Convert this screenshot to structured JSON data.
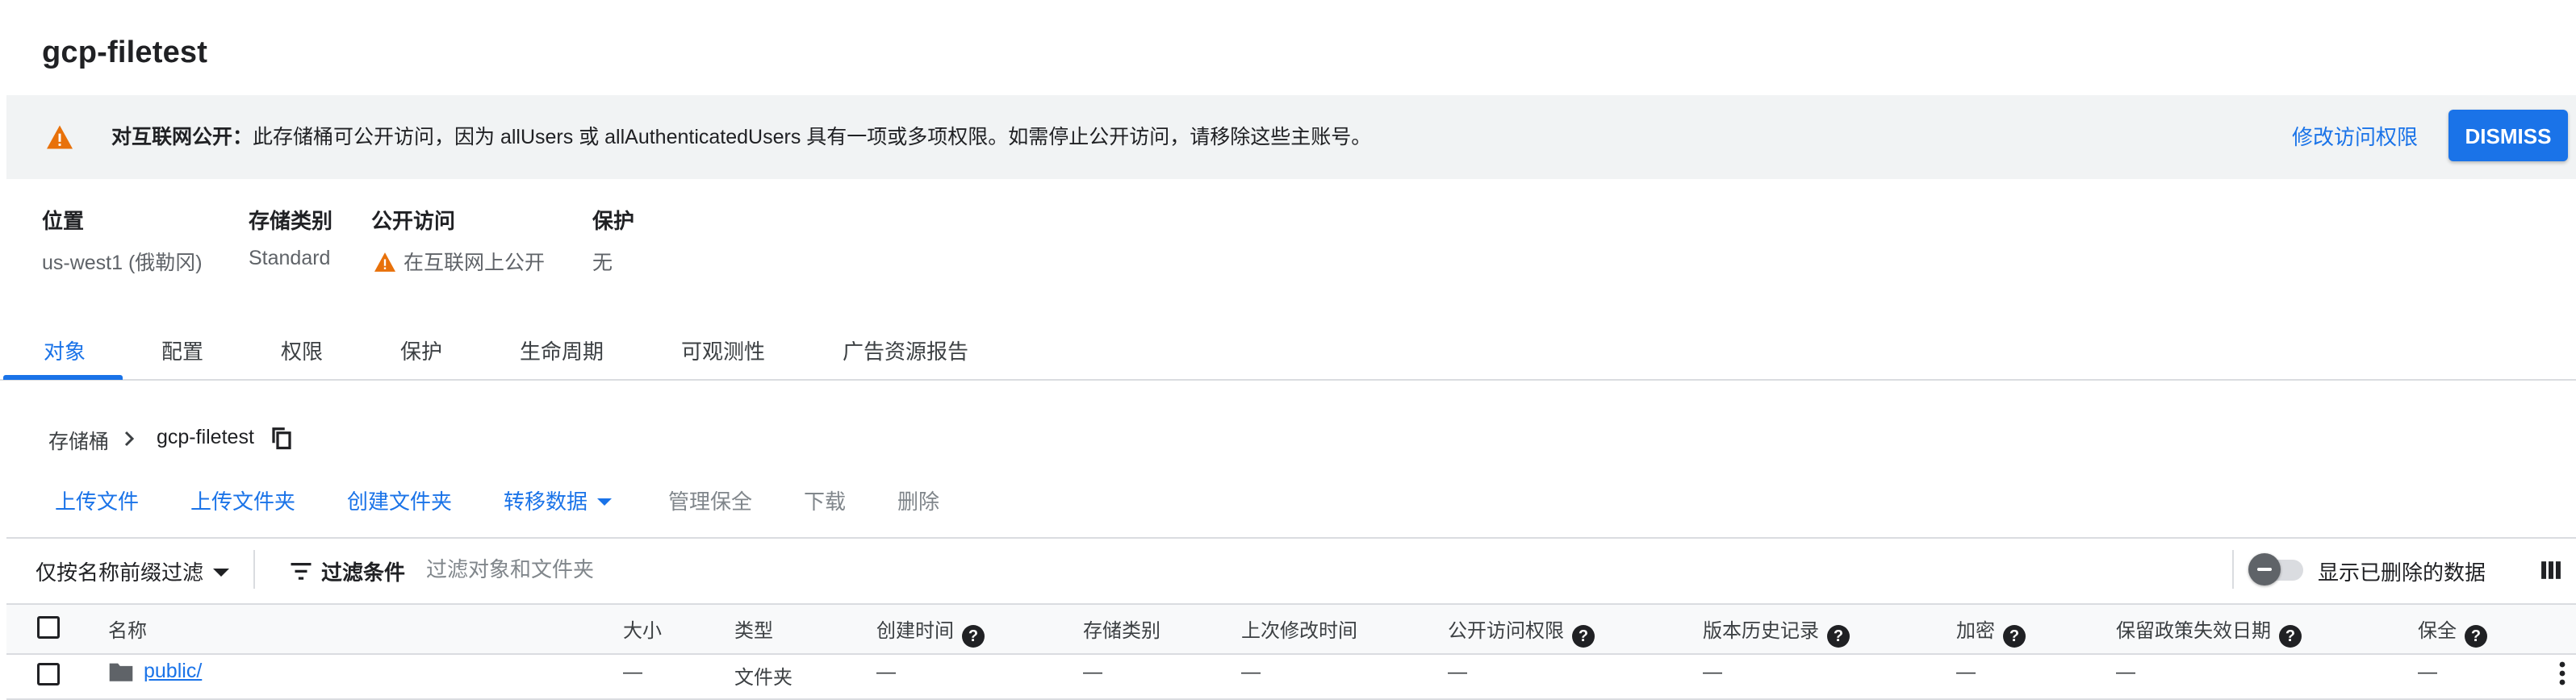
{
  "bucket": {
    "name": "gcp-filetest"
  },
  "banner": {
    "bold_text": "对互联网公开：",
    "message": "此存储桶可公开访问，因为 allUsers 或 allAuthenticatedUsers 具有一项或多项权限。如需停止公开访问，请移除这些主账号。",
    "edit_link": "修改访问权限",
    "dismiss_label": "DISMISS",
    "icon": "warning-triangle-icon",
    "warning_color": "#e8710a"
  },
  "meta": {
    "location": {
      "label": "位置",
      "value": "us-west1 (俄勒冈)"
    },
    "storage_class": {
      "label": "存储类别",
      "value": "Standard"
    },
    "public_access": {
      "label": "公开访问",
      "value": "在互联网上公开"
    },
    "protection": {
      "label": "保护",
      "value": "无"
    }
  },
  "tabs": [
    "对象",
    "配置",
    "权限",
    "保护",
    "生命周期",
    "可观测性",
    "广告资源报告"
  ],
  "active_tab": "对象",
  "breadcrumb": {
    "root": "存储桶",
    "current": "gcp-filetest"
  },
  "actions": {
    "upload_files": "上传文件",
    "upload_folder": "上传文件夹",
    "create_folder": "创建文件夹",
    "transfer_data": "转移数据",
    "manage_holds": "管理保全",
    "download": "下载",
    "delete": "删除"
  },
  "filter_bar": {
    "prefix_filter": "仅按名称前缀过滤",
    "filter_label": "过滤条件",
    "filter_placeholder": "过滤对象和文件夹",
    "show_deleted": "显示已删除的数据"
  },
  "table": {
    "headers": {
      "name": "名称",
      "size": "大小",
      "type": "类型",
      "created": "创建时间",
      "storage_class": "存储类别",
      "last_modified": "上次修改时间",
      "public_access": "公开访问权限",
      "version_history": "版本历史记录",
      "encryption": "加密",
      "retention_expiry": "保留政策失效日期",
      "hold": "保全"
    },
    "rows": [
      {
        "name": "public/",
        "size": "—",
        "type": "文件夹",
        "created": "—",
        "storage_class": "—",
        "last_modified": "—",
        "public_access": "—",
        "version_history": "—",
        "encryption": "—",
        "retention_expiry": "—",
        "hold": "—"
      }
    ]
  },
  "colors": {
    "accent": "#1a73e8",
    "warning": "#e8710a",
    "banner_bg": "#f1f3f4"
  }
}
